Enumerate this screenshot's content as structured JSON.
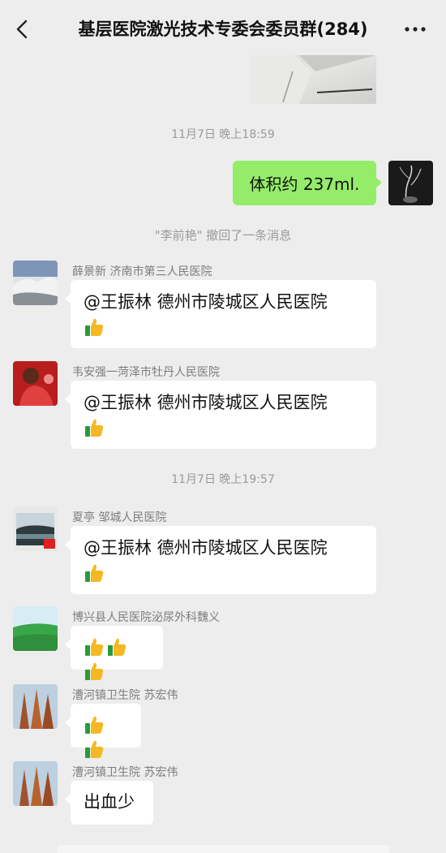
{
  "header": {
    "title": "基层医院激光技术专委会委员群(284)"
  },
  "colors": {
    "background": "#ededed",
    "green_bubble": "#95ec69",
    "white_bubble": "#ffffff",
    "meta_text": "#9a9a9a"
  },
  "timestamps": [
    "11月7日 晚上18:59",
    "11月7日 晚上19:57"
  ],
  "my_message": "体积约 237ml.",
  "recall_notice": "\"李前艳\" 撤回了一条消息",
  "messages": [
    {
      "sender": "薛景新 济南市第三人民医院",
      "text": "@王振林  德州市陵城区人民医院",
      "thumbs": 1
    },
    {
      "sender": "韦安强一菏泽市牡丹人民医院",
      "text": "@王振林  德州市陵城区人民医院",
      "thumbs": 1
    },
    {
      "sender": "夏亭  邹城人民医院",
      "text": "@王振林  德州市陵城区人民医院",
      "thumbs": 1
    },
    {
      "sender": "博兴县人民医院泌尿外科魏义",
      "text": "",
      "thumbs": 3
    },
    {
      "sender": "漕河镇卫生院   苏宏伟",
      "text": "",
      "thumbs": 2
    },
    {
      "sender": "漕河镇卫生院   苏宏伟",
      "text": "出血少",
      "thumbs": 0
    }
  ],
  "icons": {
    "back": "chevron-left-icon",
    "more": "more-dots-icon",
    "thumb": "thumbs-up-emoji"
  }
}
